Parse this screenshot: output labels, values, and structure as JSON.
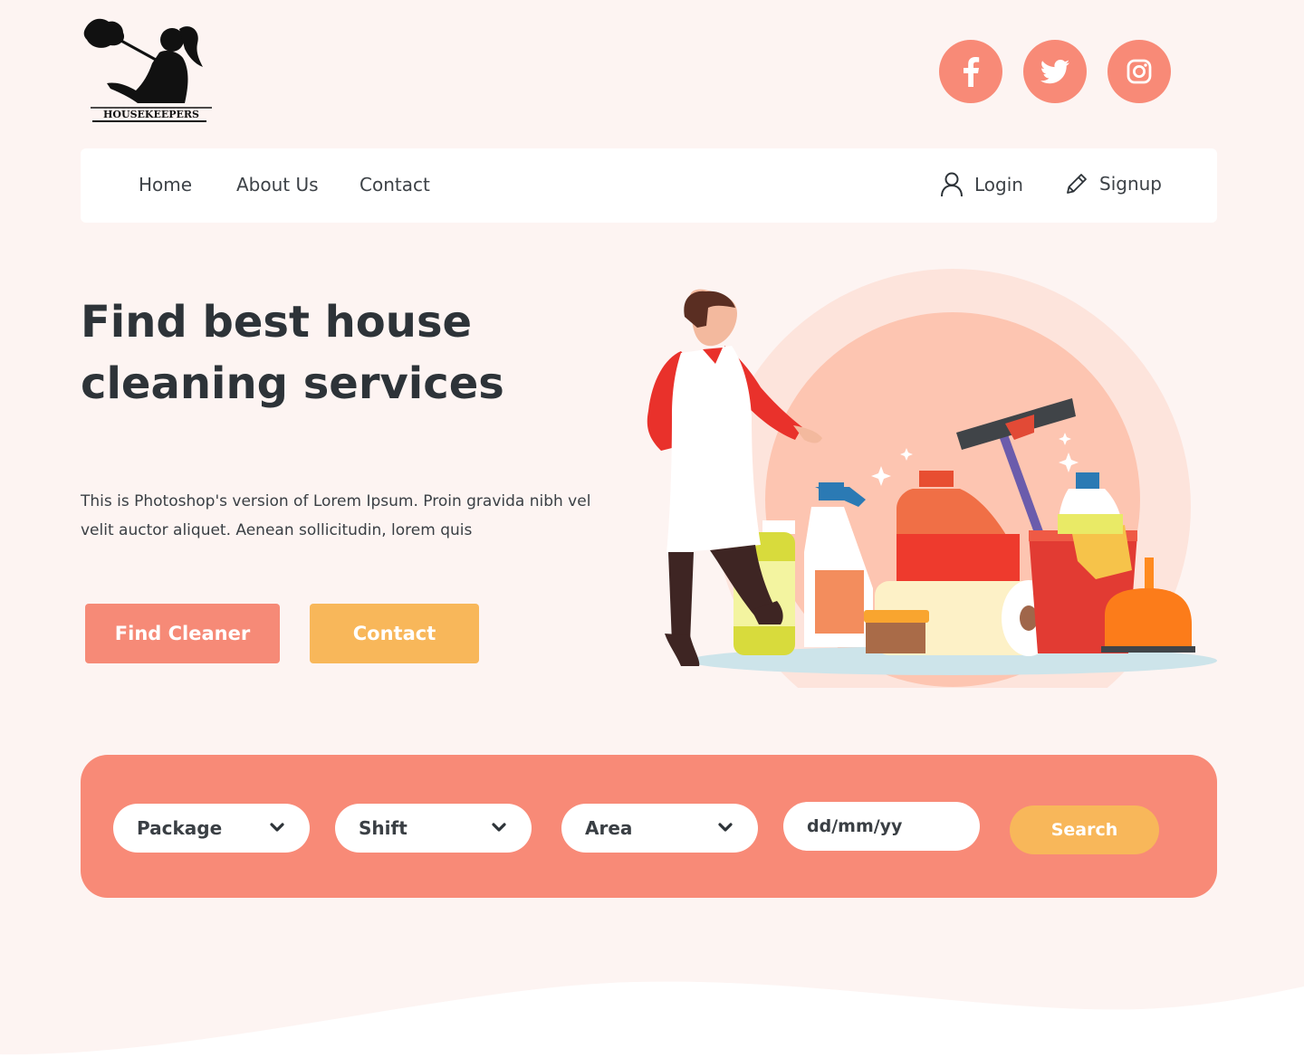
{
  "brand": {
    "logo_text": "HOUSEKEEPERS"
  },
  "social": {
    "facebook_icon": "facebook-icon",
    "twitter_icon": "twitter-icon",
    "instagram_icon": "instagram-icon"
  },
  "nav": {
    "links": [
      "Home",
      "About Us",
      "Contact"
    ],
    "login_label": "Login",
    "signup_label": "Signup"
  },
  "hero": {
    "title": "Find best house cleaning services",
    "text": "This is Photoshop's version of Lorem Ipsum.  Proin gravida nibh vel velit auctor aliquet. Aenean sollicitudin, lorem quis",
    "find_button": "Find Cleaner",
    "contact_button": "Contact"
  },
  "search": {
    "package_label": "Package",
    "shift_label": "Shift",
    "area_label": "Area",
    "date_placeholder": "dd/mm/yy",
    "button_label": "Search"
  },
  "colors": {
    "background": "#fdf4f2",
    "coral": "#f88a77",
    "orange": "#f8b75a",
    "text_dark": "#2d3338"
  }
}
